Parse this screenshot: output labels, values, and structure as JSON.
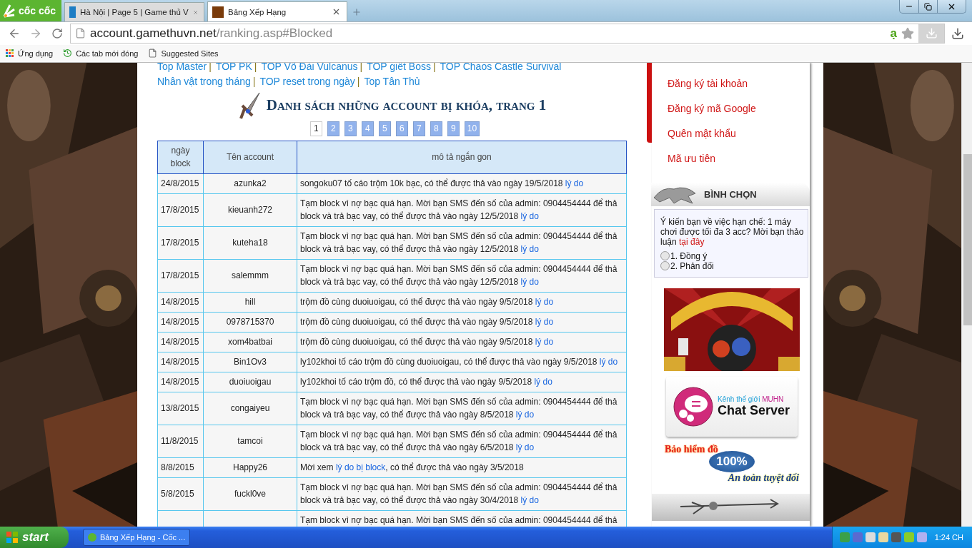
{
  "browser": {
    "logo": "cốc cốc",
    "tabs": [
      {
        "title": "Hà Nội | Page 5 | Game thủ V",
        "selected": false
      },
      {
        "title": "Bảng Xếp Hạng",
        "selected": true
      }
    ],
    "url_host": "account.gamethuvn.net",
    "url_path": "/ranking.asp#Blocked",
    "dict_badge": "ạ",
    "bookmarks": [
      {
        "kind": "apps",
        "label": "Ứng dụng"
      },
      {
        "kind": "history",
        "label": "Các tab mới đóng"
      },
      {
        "kind": "page",
        "label": "Suggested Sites"
      }
    ]
  },
  "nav": {
    "links": [
      {
        "label": "Top Master",
        "separator": "|"
      },
      {
        "label": "TOP PK",
        "separator": "|"
      },
      {
        "label": "TOP Võ Đài Vulcanus",
        "separator": "|"
      },
      {
        "label": "TOP giết Boss",
        "separator": "|"
      },
      {
        "label": "TOP Chaos Castle Survival"
      },
      {
        "label": "Nhân vật trong tháng",
        "separator": "|"
      },
      {
        "label": "TOP reset trong ngày",
        "separator": "|"
      },
      {
        "label": "Top Tân Thủ"
      }
    ]
  },
  "heading": "Danh sách những account bị khóa, trang 1",
  "pages": [
    {
      "label": "1",
      "selected": true
    },
    {
      "label": "2",
      "selected": false
    },
    {
      "label": "3",
      "selected": false
    },
    {
      "label": "4",
      "selected": false
    },
    {
      "label": "5",
      "selected": false
    },
    {
      "label": "6",
      "selected": false
    },
    {
      "label": "7",
      "selected": false
    },
    {
      "label": "8",
      "selected": false
    },
    {
      "label": "9",
      "selected": false
    },
    {
      "label": "10",
      "selected": false
    }
  ],
  "table": {
    "columns": [
      "ngày block",
      "Tên account",
      "mô tả ngắn gon"
    ],
    "rows": [
      {
        "date": "24/8/2015",
        "account": "azunka2",
        "desc": [
          {
            "kind": "text",
            "text": "songoku07 tố cáo trộm 10k bạc, có thể được thả vào ngày 19/5/2018 "
          },
          {
            "kind": "link",
            "text": "lý do"
          }
        ]
      },
      {
        "date": "17/8/2015",
        "account": "kieuanh272",
        "desc": [
          {
            "kind": "text",
            "text": "Tạm block vì nợ bạc quá hạn. Mời bạn SMS đến số của admin: 0904454444 để thả block và trả bạc vay, có thể được thả vào ngày 12/5/2018 "
          },
          {
            "kind": "link",
            "text": "lý do"
          }
        ]
      },
      {
        "date": "17/8/2015",
        "account": "kuteha18",
        "desc": [
          {
            "kind": "text",
            "text": "Tạm block vì nợ bạc quá hạn. Mời bạn SMS đến số của admin: 0904454444 để thả block và trả bạc vay, có thể được thả vào ngày 12/5/2018 "
          },
          {
            "kind": "link",
            "text": "lý do"
          }
        ]
      },
      {
        "date": "17/8/2015",
        "account": "salemmm",
        "desc": [
          {
            "kind": "text",
            "text": "Tạm block vì nợ bạc quá hạn. Mời bạn SMS đến số của admin: 0904454444 để thả block và trả bạc vay, có thể được thả vào ngày 12/5/2018 "
          },
          {
            "kind": "link",
            "text": "lý do"
          }
        ]
      },
      {
        "date": "14/8/2015",
        "account": "hill",
        "desc": [
          {
            "kind": "text",
            "text": "trộm đồ cùng duoiuoigau, có thể được thả vào ngày 9/5/2018 "
          },
          {
            "kind": "link",
            "text": "lý do"
          }
        ]
      },
      {
        "date": "14/8/2015",
        "account": "0978715370",
        "desc": [
          {
            "kind": "text",
            "text": "trộm đồ cùng duoiuoigau, có thể được thả vào ngày 9/5/2018 "
          },
          {
            "kind": "link",
            "text": "lý do"
          }
        ]
      },
      {
        "date": "14/8/2015",
        "account": "xom4batbai",
        "desc": [
          {
            "kind": "text",
            "text": "trộm đồ cùng duoiuoigau, có thể được thả vào ngày 9/5/2018 "
          },
          {
            "kind": "link",
            "text": "lý do"
          }
        ]
      },
      {
        "date": "14/8/2015",
        "account": "Bin1Ov3",
        "desc": [
          {
            "kind": "text",
            "text": "ly102khoi tố cáo trộm đồ cùng duoiuoigau, có thể được thả vào ngày 9/5/2018 "
          },
          {
            "kind": "link",
            "text": "lý do"
          }
        ]
      },
      {
        "date": "14/8/2015",
        "account": "duoiuoigau",
        "desc": [
          {
            "kind": "text",
            "text": "ly102khoi tố cáo trộm đồ, có thể được thả vào ngày 9/5/2018 "
          },
          {
            "kind": "link",
            "text": "lý do"
          }
        ]
      },
      {
        "date": "13/8/2015",
        "account": "congaiyeu",
        "desc": [
          {
            "kind": "text",
            "text": "Tạm block vì nợ bạc quá hạn. Mời bạn SMS đến số của admin: 0904454444 để thả block và trả bạc vay, có thể được thả vào ngày 8/5/2018 "
          },
          {
            "kind": "link",
            "text": "lý do"
          }
        ]
      },
      {
        "date": "11/8/2015",
        "account": "tamcoi",
        "desc": [
          {
            "kind": "text",
            "text": "Tạm block vì nợ bạc quá hạn. Mời bạn SMS đến số của admin: 0904454444 để thả block và trả bạc vay, có thể được thả vào ngày 6/5/2018 "
          },
          {
            "kind": "link",
            "text": "lý do"
          }
        ]
      },
      {
        "date": "8/8/2015",
        "account": "Happy26",
        "desc": [
          {
            "kind": "text",
            "text": "Mời xem "
          },
          {
            "kind": "link",
            "text": "lý do bị block"
          },
          {
            "kind": "text",
            "text": ", có thể được thả vào ngày 3/5/2018"
          }
        ]
      },
      {
        "date": "5/8/2015",
        "account": "fuckl0ve",
        "desc": [
          {
            "kind": "text",
            "text": "Tạm block vì nợ bạc quá hạn. Mời bạn SMS đến số của admin: 0904454444 để thả block và trả bạc vay, có thể được thả vào ngày 30/4/2018 "
          },
          {
            "kind": "link",
            "text": "lý do"
          }
        ]
      },
      {
        "desc": [
          {
            "kind": "text",
            "text": "Tạm block vì nợ bạc quá hạn. Mời bạn SMS đến số của admin: 0904454444 để thả"
          }
        ]
      }
    ]
  },
  "sidebar": {
    "links": [
      "Đăng ký tài khoản",
      "Đăng ký mã Google",
      "Quên mật khẩu",
      "Mã ưu tiên"
    ],
    "poll": {
      "title": "BÌNH CHỌN",
      "question": "Ý kiến bạn về việc hạn chế: 1 máy chơi được tối đa 3 acc? Mời bạn thảo luận ",
      "question_link": "tại đây",
      "options": [
        {
          "label": "1. Đồng ý",
          "selected": false
        },
        {
          "label": "2. Phản đối",
          "selected": false
        }
      ]
    },
    "chat_banner": {
      "caption": "Kênh thế giới ",
      "caption_brand": "MUHN",
      "title": "Chat Server"
    },
    "insurance_banner": {
      "line1": "Bảo hiểm đồ",
      "badge": "100%",
      "line2": "An toàn tuyệt đối"
    }
  },
  "taskbar": {
    "start": "start",
    "task": "Bảng Xếp Hạng - Cốc ...",
    "clock": "1:24 CH"
  }
}
